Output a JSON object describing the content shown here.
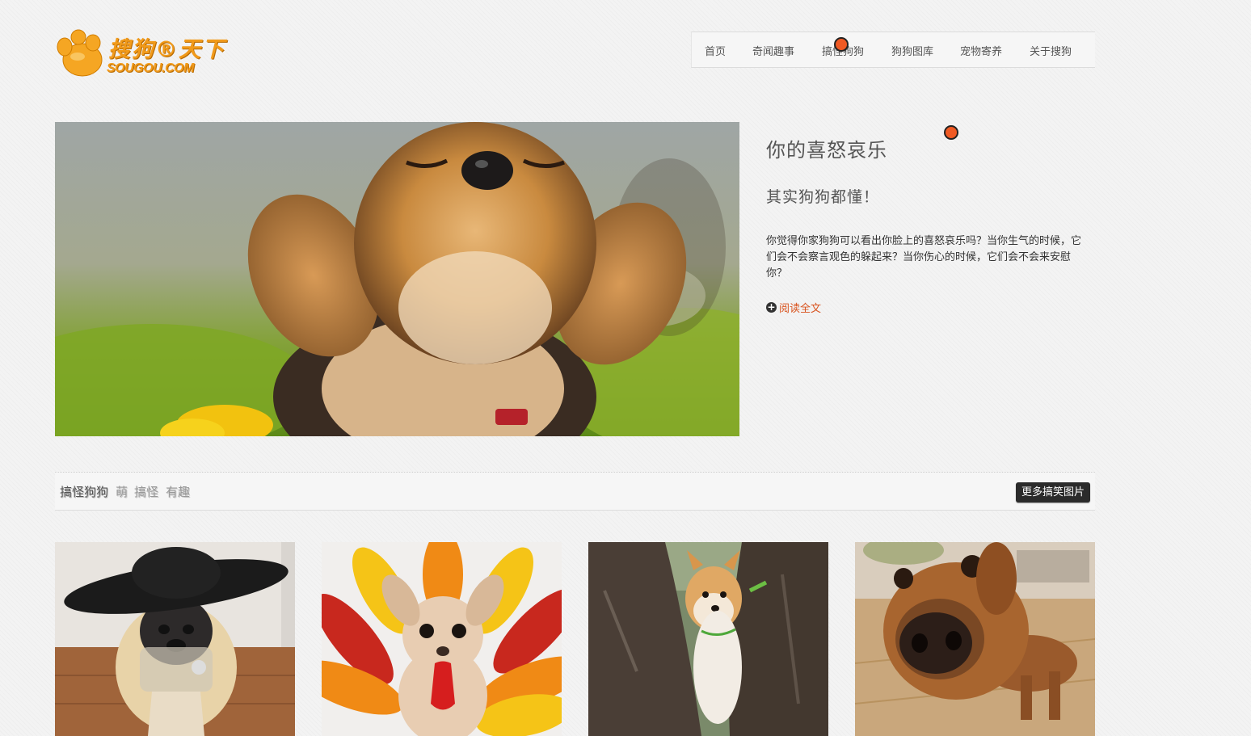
{
  "logo": {
    "cn_text": "搜狗®天下",
    "en_text": "SOUGOU.COM"
  },
  "nav": {
    "items": [
      {
        "label": "首页"
      },
      {
        "label": "奇闻趣事"
      },
      {
        "label": "搞怪狗狗"
      },
      {
        "label": "狗狗图库"
      },
      {
        "label": "宠物寄养"
      },
      {
        "label": "关于搜狗"
      }
    ]
  },
  "hero": {
    "title": "你的喜怒哀乐",
    "subtitle": "其实狗狗都懂！",
    "description": "你觉得你家狗狗可以看出你脸上的喜怒哀乐吗？当你生气的时候，它们会不会察言观色的躲起来？当你伤心的时候，它们会不会来安慰你？",
    "read_more": "阅读全文"
  },
  "section": {
    "title": "搞怪狗狗",
    "tags": [
      "萌",
      "搞怪",
      "有趣"
    ],
    "more_button": "更多搞笑图片"
  },
  "colors": {
    "accent": "#d9531e",
    "logo": "#f19a1a",
    "marker": "#f05a24"
  }
}
